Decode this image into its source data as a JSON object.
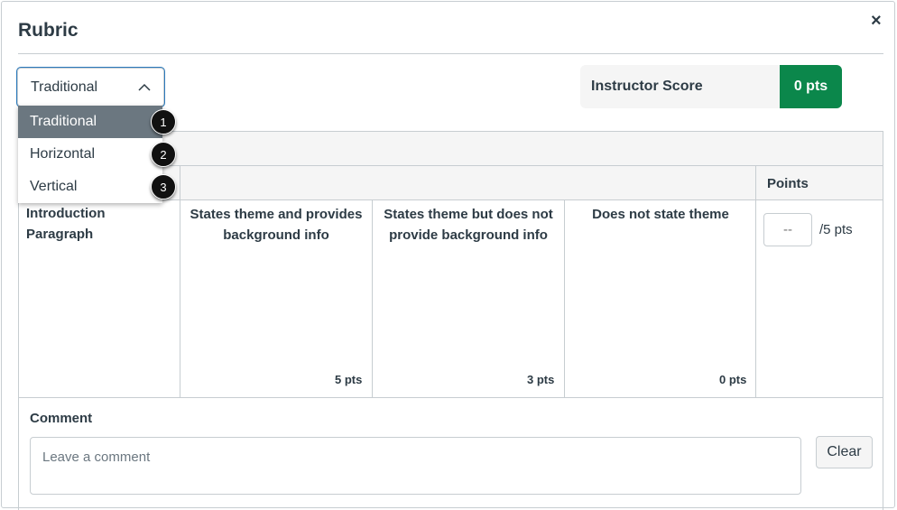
{
  "dialog": {
    "title": "Rubric",
    "close_label": "×"
  },
  "view_select": {
    "value": "Traditional",
    "options": [
      "Traditional",
      "Horizontal",
      "Vertical"
    ],
    "callouts": [
      "1",
      "2",
      "3"
    ]
  },
  "score": {
    "label": "Instructor Score",
    "value": "0 pts",
    "accent": "#0B874B"
  },
  "table": {
    "points_header": "Points",
    "criterion": "Introduction Paragraph",
    "ratings": [
      {
        "description": "States theme and provides background info",
        "points": "5 pts"
      },
      {
        "description": "States theme but does not provide background info",
        "points": "3 pts"
      },
      {
        "description": "Does not state theme",
        "points": "0 pts"
      }
    ],
    "points_input_placeholder": "--",
    "points_possible": "/5 pts"
  },
  "comment": {
    "label": "Comment",
    "placeholder": "Leave a comment",
    "clear_label": "Clear"
  }
}
